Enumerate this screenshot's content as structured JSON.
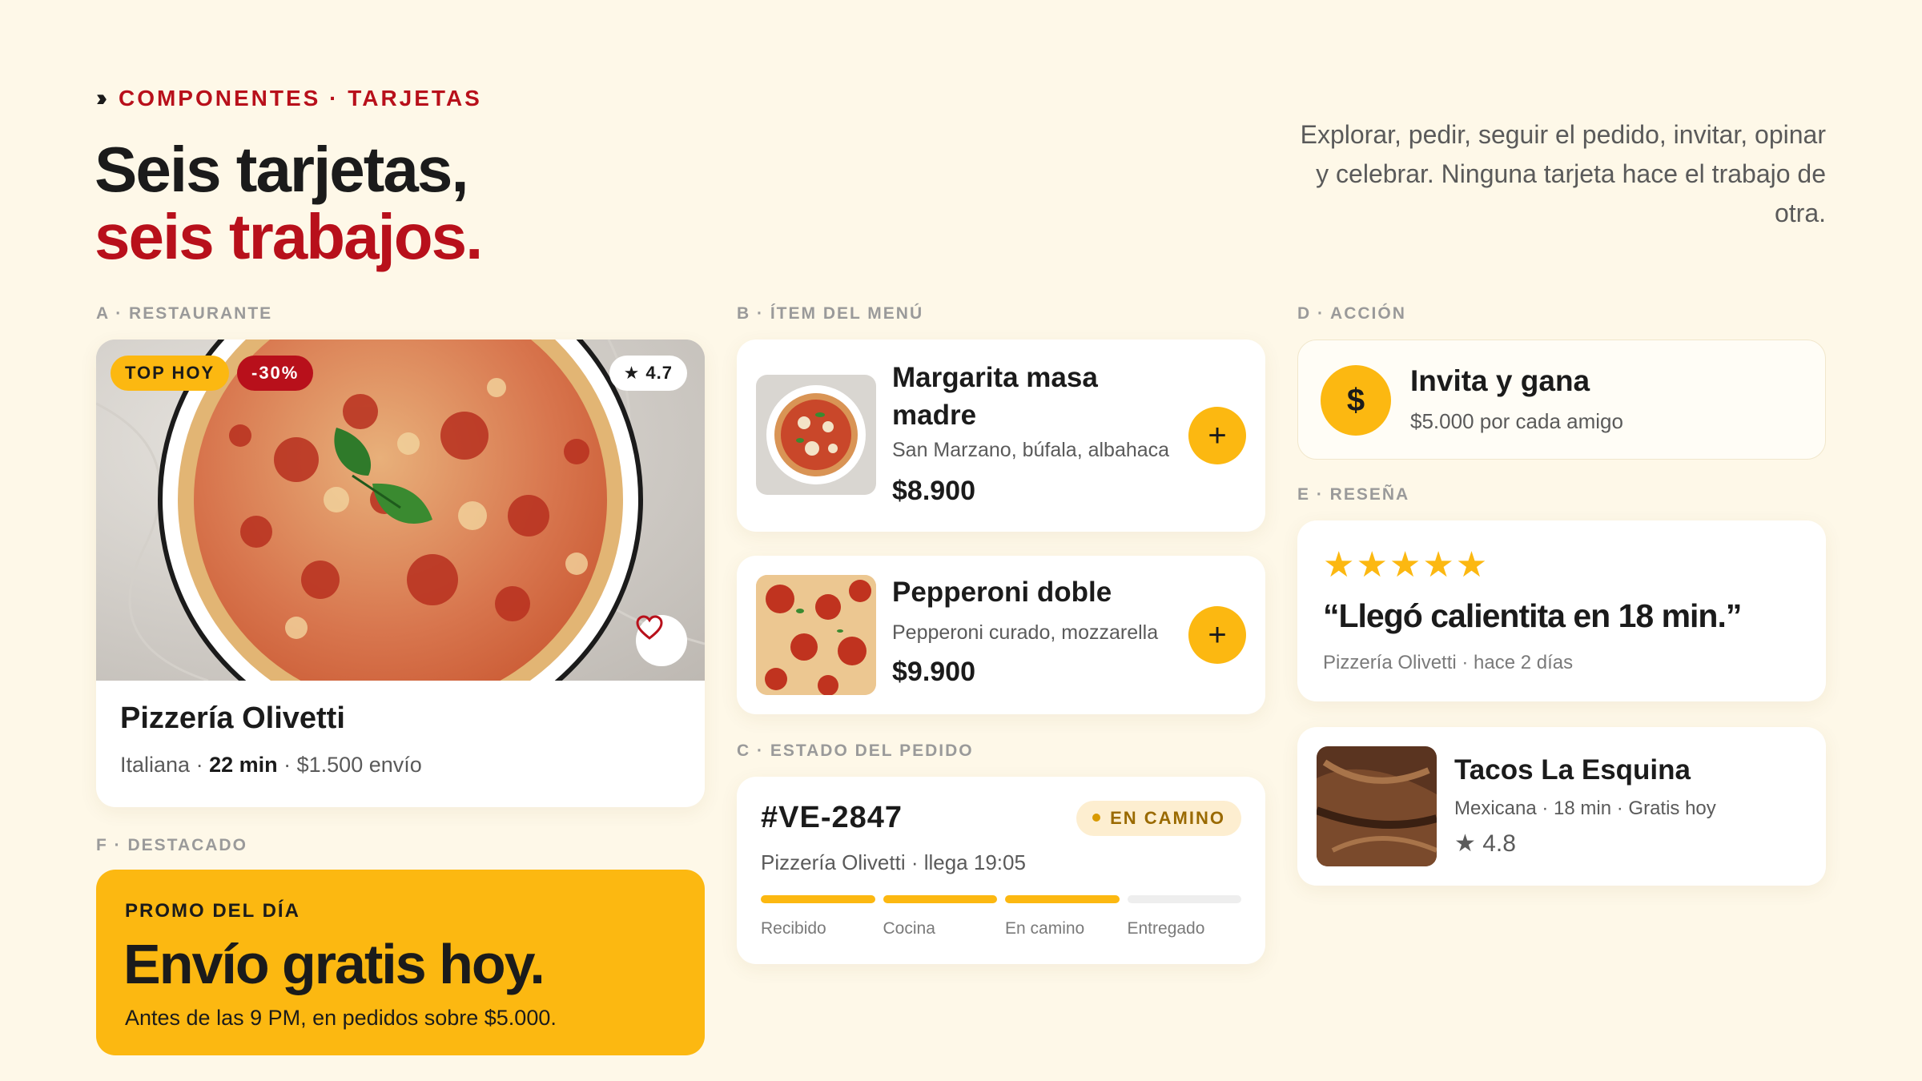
{
  "header": {
    "eyebrow_icon": "triple-chevron-icon",
    "eyebrow": "COMPONENTES · TARJETAS",
    "title_line1": "Seis tarjetas,",
    "title_line2": "seis trabajos.",
    "intro": "Explorar, pedir, seguir el pedido, invitar, opinar y celebrar. Ninguna tarjeta hace el trabajo de otra."
  },
  "colors": {
    "background": "#fef8e8",
    "accent_red": "#b8101b",
    "accent_yellow": "#fcb811"
  },
  "sections": {
    "a": "A · RESTAURANTE",
    "b": "B · ÍTEM DEL MENÚ",
    "c": "C · ESTADO DEL PEDIDO",
    "d": "D · ACCIÓN",
    "e": "E · RESEÑA",
    "f": "F · DESTACADO"
  },
  "restaurant_card": {
    "badge_top": "TOP HOY",
    "badge_discount": "-30%",
    "rating_badge": "★ 4.7",
    "favorite_icon": "heart-icon",
    "name": "Pizzería Olivetti",
    "cuisine": "Italiana",
    "time": "22 min",
    "delivery": "$1.500 envío"
  },
  "menu_items": [
    {
      "name": "Margarita masa madre",
      "desc": "San Marzano, búfala, albahaca",
      "price": "$8.900",
      "add_label": "+"
    },
    {
      "name": "Pepperoni doble",
      "desc": "Pepperoni curado, mozzarella",
      "price": "$9.900",
      "add_label": "+"
    }
  ],
  "order": {
    "id": "#VE-2847",
    "status": "EN CAMINO",
    "info": "Pizzería Olivetti · llega 19:05",
    "steps": [
      "Recibido",
      "Cocina",
      "En camino",
      "Entregado"
    ],
    "completed_steps": 3
  },
  "action_card": {
    "icon": "$",
    "title": "Invita y gana",
    "subtitle": "$5.000 por cada amigo"
  },
  "review_card": {
    "stars": "★★★★★",
    "quote": "“Llegó calientita en 18 min.”",
    "byline": "Pizzería Olivetti · hace 2 días"
  },
  "restaurant_mini": {
    "name": "Tacos La Esquina",
    "meta": "Mexicana · 18 min · Gratis hoy",
    "rating": "★ 4.8"
  },
  "promo": {
    "eyebrow": "PROMO DEL DÍA",
    "headline": "Envío gratis hoy.",
    "sub": "Antes de las 9 PM, en pedidos sobre $5.000."
  }
}
